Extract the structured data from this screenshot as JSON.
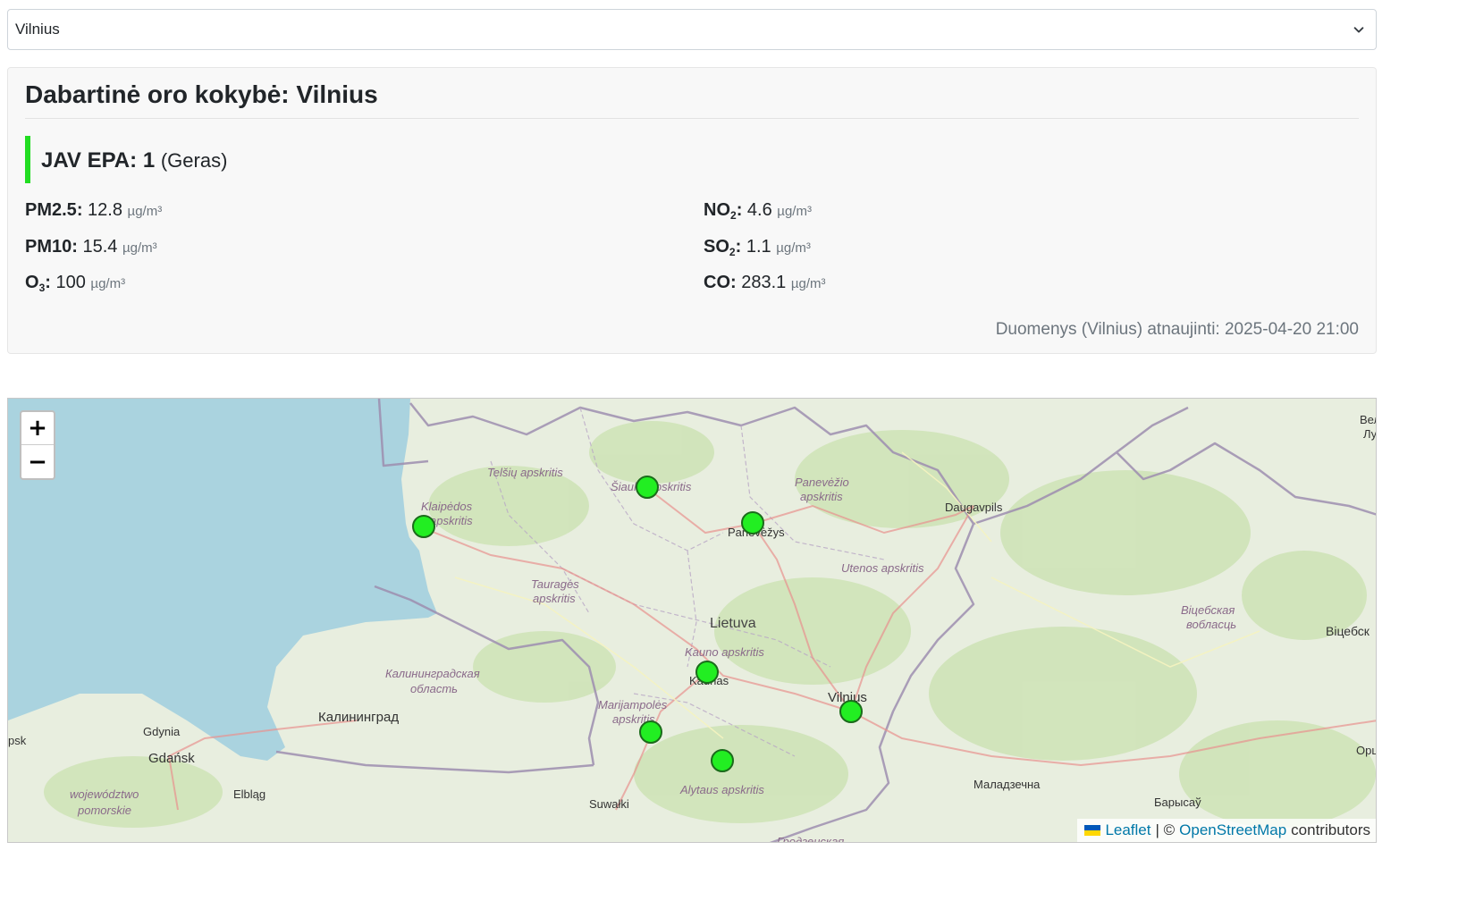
{
  "city_select": {
    "value": "Vilnius"
  },
  "current": {
    "title": "Dabartinė oro kokybė: Vilnius",
    "epa_label": "JAV EPA:",
    "epa_value": "1",
    "epa_category": "(Geras)",
    "epa_color": "#22dd22",
    "pollutants": [
      {
        "name": "PM2.5",
        "sub": "",
        "value": "12.8",
        "unit": "µg/m³"
      },
      {
        "name": "PM10",
        "sub": "",
        "value": "15.4",
        "unit": "µg/m³"
      },
      {
        "name": "O",
        "sub": "3",
        "value": "100",
        "unit": "µg/m³"
      },
      {
        "name": "NO",
        "sub": "2",
        "value": "4.6",
        "unit": "µg/m³"
      },
      {
        "name": "SO",
        "sub": "2",
        "value": "1.1",
        "unit": "µg/m³"
      },
      {
        "name": "CO",
        "sub": "",
        "value": "283.1",
        "unit": "µg/m³"
      }
    ],
    "updated": "Duomenys (Vilnius) atnaujinti: 2025-04-20 21:00"
  },
  "map": {
    "zoom_in": "+",
    "zoom_out": "−",
    "attribution": {
      "leaflet": "Leaflet",
      "sep": "| ©",
      "osm": "OpenStreetMap",
      "contributors": "contributors"
    },
    "labels": {
      "telsiu": "Telšių apskritis",
      "siauliu": "Šiaulių apskritis",
      "panevezio_1": "Panevėžio",
      "panevezio_2": "apskritis",
      "klaipedos_1": "Klaipėdos",
      "klaipedos_2": "apskritis",
      "panevezys": "Panevėžys",
      "daugavpils": "Daugavpils",
      "utenos": "Utenos apskritis",
      "taurages_1": "Tauragės",
      "taurages_2": "apskritis",
      "lietuva": "Lietuva",
      "kauno": "Kauno apskritis",
      "kaunas": "Kaunas",
      "vitebsk_region_1": "Віцебская",
      "vitebsk_region_2": "вобласць",
      "vitebsk": "Віцебск",
      "kaliningrad_region_1": "Калининградская",
      "kaliningrad_region_2": "область",
      "kaliningrad": "Калининград",
      "marijampoles_1": "Marijampolės",
      "marijampoles_2": "apskritis",
      "vilnius": "Vilnius",
      "gdynia": "Gdynia",
      "gdansk": "Gdańsk",
      "elblag": "Elbląg",
      "pomorskie_1": "województwo",
      "pomorskie_2": "pomorskie",
      "suwalki": "Suwałki",
      "alytaus": "Alytaus apskritis",
      "molodechno": "Маладзечна",
      "borisov": "Барысаў",
      "psk": "psk",
      "grodno": "Гродзенская",
      "veli_1": "Вел",
      "veli_2": "Лу",
      "orsha": "Орш"
    },
    "marker_color": "#22ee22",
    "stations": [
      "Klaipėda",
      "Šiauliai",
      "Panevėžys",
      "Kaunas",
      "Marijampolė",
      "Alytus",
      "Vilnius"
    ]
  }
}
